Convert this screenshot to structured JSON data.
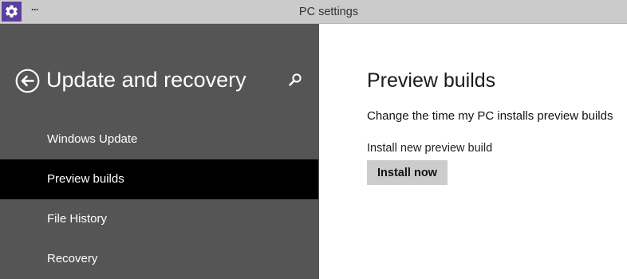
{
  "window": {
    "title": "PC settings",
    "menu_glyph": "···",
    "app_icon": "gear-icon",
    "accent_color": "#5b3fa0"
  },
  "left_pane": {
    "background": "#555555",
    "back_icon": "back-arrow-icon",
    "section_title": "Update and recovery",
    "search_icon": "search-icon",
    "nav_items": [
      {
        "label": "Windows Update",
        "selected": false
      },
      {
        "label": "Preview builds",
        "selected": true
      },
      {
        "label": "File History",
        "selected": false
      },
      {
        "label": "Recovery",
        "selected": false
      }
    ]
  },
  "main": {
    "page_title": "Preview builds",
    "link_text": "Change the time my PC installs preview builds",
    "field_label": "Install new preview build",
    "install_button_label": "Install now"
  }
}
